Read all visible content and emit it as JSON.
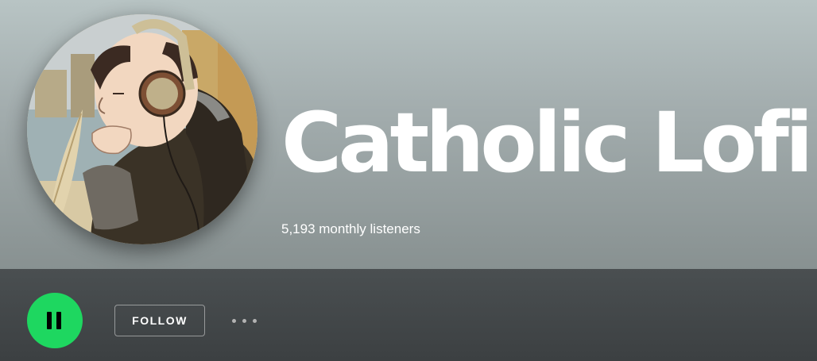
{
  "artist": {
    "name": "Catholic Lofi",
    "monthly_listeners": "5,193 monthly listeners"
  },
  "actions": {
    "play_state": "playing",
    "play_icon": "pause-icon",
    "follow_label": "FOLLOW",
    "more_icon": "more-options-icon"
  },
  "colors": {
    "accent": "#1ed760",
    "hero_gradient_top": "#b8c4c4",
    "hero_gradient_bottom": "#889191",
    "bar_background": "#3e4244"
  }
}
